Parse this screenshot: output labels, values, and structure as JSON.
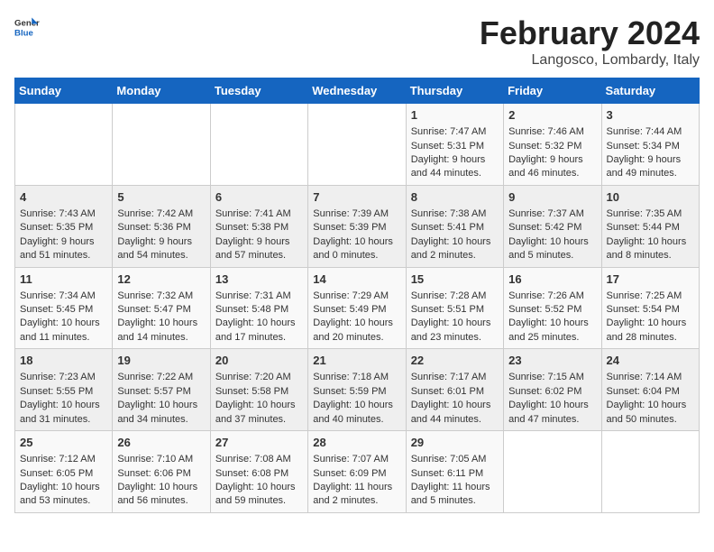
{
  "header": {
    "logo_general": "General",
    "logo_blue": "Blue",
    "month_title": "February 2024",
    "location": "Langosco, Lombardy, Italy"
  },
  "days_of_week": [
    "Sunday",
    "Monday",
    "Tuesday",
    "Wednesday",
    "Thursday",
    "Friday",
    "Saturday"
  ],
  "weeks": [
    [
      {
        "day": "",
        "info": ""
      },
      {
        "day": "",
        "info": ""
      },
      {
        "day": "",
        "info": ""
      },
      {
        "day": "",
        "info": ""
      },
      {
        "day": "1",
        "info": "Sunrise: 7:47 AM\nSunset: 5:31 PM\nDaylight: 9 hours\nand 44 minutes."
      },
      {
        "day": "2",
        "info": "Sunrise: 7:46 AM\nSunset: 5:32 PM\nDaylight: 9 hours\nand 46 minutes."
      },
      {
        "day": "3",
        "info": "Sunrise: 7:44 AM\nSunset: 5:34 PM\nDaylight: 9 hours\nand 49 minutes."
      }
    ],
    [
      {
        "day": "4",
        "info": "Sunrise: 7:43 AM\nSunset: 5:35 PM\nDaylight: 9 hours\nand 51 minutes."
      },
      {
        "day": "5",
        "info": "Sunrise: 7:42 AM\nSunset: 5:36 PM\nDaylight: 9 hours\nand 54 minutes."
      },
      {
        "day": "6",
        "info": "Sunrise: 7:41 AM\nSunset: 5:38 PM\nDaylight: 9 hours\nand 57 minutes."
      },
      {
        "day": "7",
        "info": "Sunrise: 7:39 AM\nSunset: 5:39 PM\nDaylight: 10 hours\nand 0 minutes."
      },
      {
        "day": "8",
        "info": "Sunrise: 7:38 AM\nSunset: 5:41 PM\nDaylight: 10 hours\nand 2 minutes."
      },
      {
        "day": "9",
        "info": "Sunrise: 7:37 AM\nSunset: 5:42 PM\nDaylight: 10 hours\nand 5 minutes."
      },
      {
        "day": "10",
        "info": "Sunrise: 7:35 AM\nSunset: 5:44 PM\nDaylight: 10 hours\nand 8 minutes."
      }
    ],
    [
      {
        "day": "11",
        "info": "Sunrise: 7:34 AM\nSunset: 5:45 PM\nDaylight: 10 hours\nand 11 minutes."
      },
      {
        "day": "12",
        "info": "Sunrise: 7:32 AM\nSunset: 5:47 PM\nDaylight: 10 hours\nand 14 minutes."
      },
      {
        "day": "13",
        "info": "Sunrise: 7:31 AM\nSunset: 5:48 PM\nDaylight: 10 hours\nand 17 minutes."
      },
      {
        "day": "14",
        "info": "Sunrise: 7:29 AM\nSunset: 5:49 PM\nDaylight: 10 hours\nand 20 minutes."
      },
      {
        "day": "15",
        "info": "Sunrise: 7:28 AM\nSunset: 5:51 PM\nDaylight: 10 hours\nand 23 minutes."
      },
      {
        "day": "16",
        "info": "Sunrise: 7:26 AM\nSunset: 5:52 PM\nDaylight: 10 hours\nand 25 minutes."
      },
      {
        "day": "17",
        "info": "Sunrise: 7:25 AM\nSunset: 5:54 PM\nDaylight: 10 hours\nand 28 minutes."
      }
    ],
    [
      {
        "day": "18",
        "info": "Sunrise: 7:23 AM\nSunset: 5:55 PM\nDaylight: 10 hours\nand 31 minutes."
      },
      {
        "day": "19",
        "info": "Sunrise: 7:22 AM\nSunset: 5:57 PM\nDaylight: 10 hours\nand 34 minutes."
      },
      {
        "day": "20",
        "info": "Sunrise: 7:20 AM\nSunset: 5:58 PM\nDaylight: 10 hours\nand 37 minutes."
      },
      {
        "day": "21",
        "info": "Sunrise: 7:18 AM\nSunset: 5:59 PM\nDaylight: 10 hours\nand 40 minutes."
      },
      {
        "day": "22",
        "info": "Sunrise: 7:17 AM\nSunset: 6:01 PM\nDaylight: 10 hours\nand 44 minutes."
      },
      {
        "day": "23",
        "info": "Sunrise: 7:15 AM\nSunset: 6:02 PM\nDaylight: 10 hours\nand 47 minutes."
      },
      {
        "day": "24",
        "info": "Sunrise: 7:14 AM\nSunset: 6:04 PM\nDaylight: 10 hours\nand 50 minutes."
      }
    ],
    [
      {
        "day": "25",
        "info": "Sunrise: 7:12 AM\nSunset: 6:05 PM\nDaylight: 10 hours\nand 53 minutes."
      },
      {
        "day": "26",
        "info": "Sunrise: 7:10 AM\nSunset: 6:06 PM\nDaylight: 10 hours\nand 56 minutes."
      },
      {
        "day": "27",
        "info": "Sunrise: 7:08 AM\nSunset: 6:08 PM\nDaylight: 10 hours\nand 59 minutes."
      },
      {
        "day": "28",
        "info": "Sunrise: 7:07 AM\nSunset: 6:09 PM\nDaylight: 11 hours\nand 2 minutes."
      },
      {
        "day": "29",
        "info": "Sunrise: 7:05 AM\nSunset: 6:11 PM\nDaylight: 11 hours\nand 5 minutes."
      },
      {
        "day": "",
        "info": ""
      },
      {
        "day": "",
        "info": ""
      }
    ]
  ]
}
